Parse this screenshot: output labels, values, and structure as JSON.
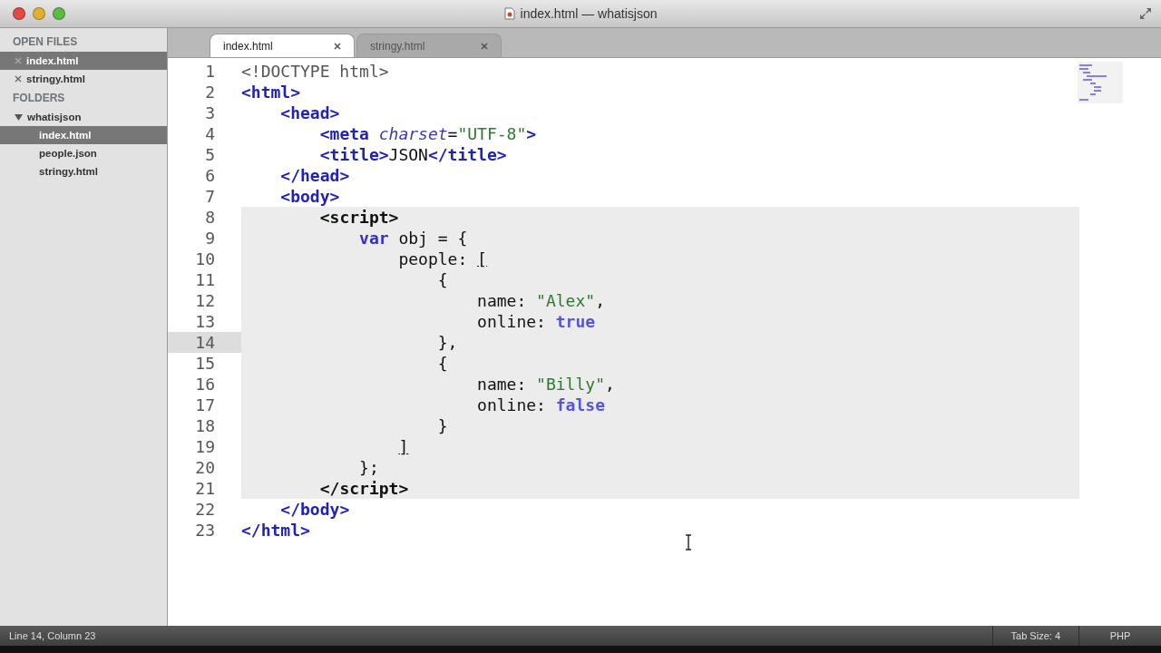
{
  "window": {
    "title": "index.html — whatisjson"
  },
  "open_files": {
    "heading": "OPEN FILES",
    "items": [
      {
        "label": "index.html",
        "selected": true
      },
      {
        "label": "stringy.html",
        "selected": false
      }
    ]
  },
  "folders": {
    "heading": "FOLDERS",
    "tree": [
      {
        "label": "whatisjson",
        "expanded": true,
        "selected": false,
        "children": [
          {
            "label": "index.html",
            "selected": true
          },
          {
            "label": "people.json",
            "selected": false
          },
          {
            "label": "stringy.html",
            "selected": false
          }
        ]
      }
    ]
  },
  "tabs": [
    {
      "label": "index.html",
      "selected": true
    },
    {
      "label": "stringy.html",
      "selected": false
    }
  ],
  "editor": {
    "lines": [
      {
        "number": "1",
        "selected": false,
        "current": false,
        "tokens": [
          {
            "kind": "doctype",
            "text": "<!DOCTYPE html>"
          }
        ]
      },
      {
        "number": "2",
        "selected": false,
        "current": false,
        "tokens": [
          {
            "kind": "tag",
            "text": "<html>"
          }
        ]
      },
      {
        "number": "3",
        "selected": false,
        "current": false,
        "tokens": [
          {
            "kind": "tag",
            "text": "    <head>"
          }
        ]
      },
      {
        "number": "4",
        "selected": false,
        "current": false,
        "tokens": [
          {
            "kind": "tag",
            "text": "        <meta "
          },
          {
            "kind": "attr",
            "text": "charset"
          },
          {
            "kind": "plain",
            "text": "="
          },
          {
            "kind": "string",
            "text": "\"UTF-8\""
          },
          {
            "kind": "tag",
            "text": ">"
          }
        ]
      },
      {
        "number": "5",
        "selected": false,
        "current": false,
        "tokens": [
          {
            "kind": "tag",
            "text": "        <title>"
          },
          {
            "kind": "plain",
            "text": "JSON"
          },
          {
            "kind": "tag",
            "text": "</title>"
          }
        ]
      },
      {
        "number": "6",
        "selected": false,
        "current": false,
        "tokens": [
          {
            "kind": "tag",
            "text": "    </head>"
          }
        ]
      },
      {
        "number": "7",
        "selected": false,
        "current": false,
        "tokens": [
          {
            "kind": "tag",
            "text": "    <body>"
          }
        ]
      },
      {
        "number": "8",
        "selected": true,
        "current": false,
        "tokens": [
          {
            "kind": "script",
            "text": "        <script>"
          }
        ]
      },
      {
        "number": "9",
        "selected": true,
        "current": false,
        "tokens": [
          {
            "kind": "keyword",
            "text": "            var"
          },
          {
            "kind": "plain",
            "text": " obj = {"
          }
        ]
      },
      {
        "number": "10",
        "selected": true,
        "current": false,
        "tokens": [
          {
            "kind": "plain",
            "text": "                people: "
          },
          {
            "kind": "bracket",
            "text": "["
          }
        ]
      },
      {
        "number": "11",
        "selected": true,
        "current": false,
        "tokens": [
          {
            "kind": "plain",
            "text": "                    {"
          }
        ]
      },
      {
        "number": "12",
        "selected": true,
        "current": false,
        "tokens": [
          {
            "kind": "plain",
            "text": "                        name: "
          },
          {
            "kind": "string",
            "text": "\"Alex\""
          },
          {
            "kind": "plain",
            "text": ","
          }
        ]
      },
      {
        "number": "13",
        "selected": true,
        "current": false,
        "tokens": [
          {
            "kind": "plain",
            "text": "                        online: "
          },
          {
            "kind": "constant",
            "text": "true"
          }
        ]
      },
      {
        "number": "14",
        "selected": true,
        "current": true,
        "tokens": [
          {
            "kind": "plain",
            "text": "                    },"
          }
        ]
      },
      {
        "number": "15",
        "selected": true,
        "current": false,
        "tokens": [
          {
            "kind": "plain",
            "text": "                    {"
          }
        ]
      },
      {
        "number": "16",
        "selected": true,
        "current": false,
        "tokens": [
          {
            "kind": "plain",
            "text": "                        name: "
          },
          {
            "kind": "string",
            "text": "\"Billy\""
          },
          {
            "kind": "plain",
            "text": ","
          }
        ]
      },
      {
        "number": "17",
        "selected": true,
        "current": false,
        "tokens": [
          {
            "kind": "plain",
            "text": "                        online: "
          },
          {
            "kind": "constant",
            "text": "false"
          }
        ]
      },
      {
        "number": "18",
        "selected": true,
        "current": false,
        "tokens": [
          {
            "kind": "plain",
            "text": "                    }"
          }
        ]
      },
      {
        "number": "19",
        "selected": true,
        "current": false,
        "tokens": [
          {
            "kind": "bracket",
            "text": "                ]"
          }
        ]
      },
      {
        "number": "20",
        "selected": true,
        "current": false,
        "tokens": [
          {
            "kind": "plain",
            "text": "            };"
          }
        ]
      },
      {
        "number": "21",
        "selected": true,
        "current": false,
        "tokens": [
          {
            "kind": "script",
            "text": "        </script>"
          }
        ]
      },
      {
        "number": "22",
        "selected": false,
        "current": false,
        "tokens": [
          {
            "kind": "tag",
            "text": "    </body>"
          }
        ]
      },
      {
        "number": "23",
        "selected": false,
        "current": false,
        "tokens": [
          {
            "kind": "tag",
            "text": "</html>"
          }
        ]
      }
    ]
  },
  "status_bar": {
    "position": "Line 14, Column 23",
    "tab_size": "Tab Size: 4",
    "syntax": "PHP"
  }
}
